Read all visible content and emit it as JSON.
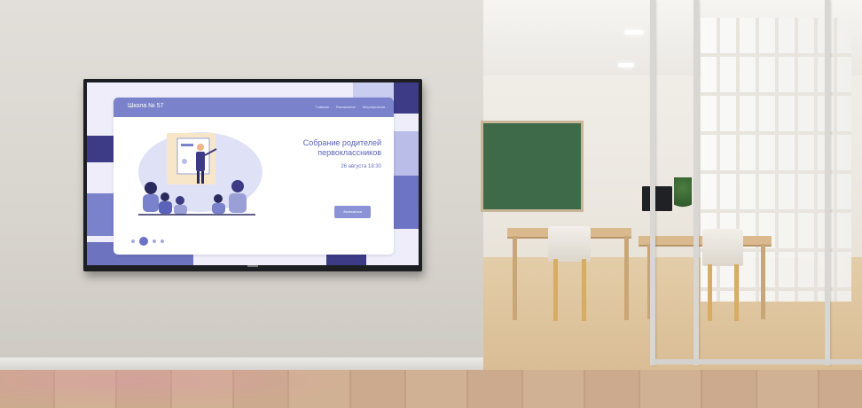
{
  "screen": {
    "school_name": "Школа № 57",
    "nav": [
      "Главная",
      "Расписание",
      "Мероприятия"
    ],
    "event": {
      "title_line1": "Собрание родителей",
      "title_line2": "первоклассников",
      "date": "26 августа 18:30"
    },
    "button_label": "Записаться",
    "slider": {
      "dots": 4,
      "active_index": 1
    },
    "colors": {
      "header": "#7a82cb",
      "accent_dark": "#3d3a86",
      "accent_light": "#b9bde8",
      "text": "#5b63b8"
    }
  }
}
